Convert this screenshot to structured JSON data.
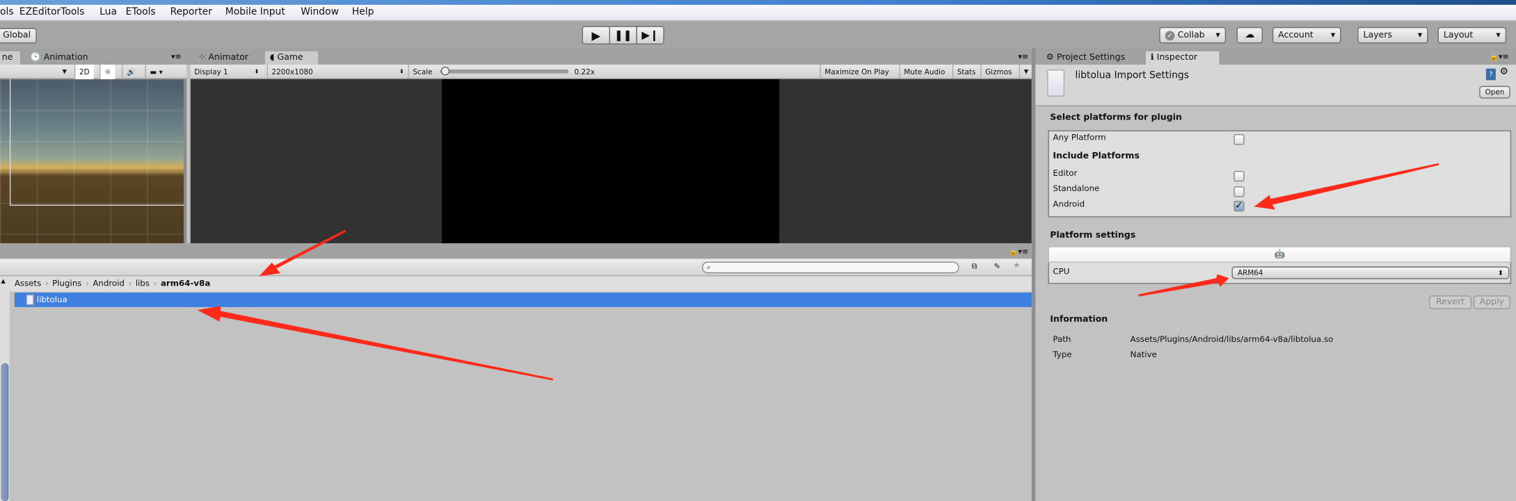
{
  "menu": {
    "items": [
      "ols",
      "EZEditorTools",
      "Lua",
      "ETools",
      "Reporter",
      "Mobile Input",
      "Window",
      "Help"
    ]
  },
  "toolbar": {
    "global_label": "Global",
    "collab_label": "Collab",
    "account_label": "Account",
    "layers_label": "Layers",
    "layout_label": "Layout"
  },
  "scene_panel": {
    "tabs": [
      "ne",
      "Animation"
    ],
    "mode_2d": "2D"
  },
  "game_panel": {
    "tabs": [
      "Animator",
      "Game"
    ],
    "display": "Display 1",
    "resolution": "2200x1080",
    "scale_label": "Scale",
    "scale_value": "0.22x",
    "scale_fraction": 0.02,
    "buttons": [
      "Maximize On Play",
      "Mute Audio",
      "Stats",
      "Gizmos"
    ]
  },
  "project_panel": {
    "breadcrumb": [
      "Assets",
      "Plugins",
      "Android",
      "libs",
      "arm64-v8a"
    ],
    "files": [
      "libtolua"
    ],
    "search_placeholder": ""
  },
  "inspector": {
    "tabs": [
      "Project Settings",
      "Inspector"
    ],
    "title": "libtolua Import Settings",
    "open_label": "Open",
    "select_platforms_heading": "Select platforms for plugin",
    "any_platform": {
      "label": "Any Platform",
      "checked": false
    },
    "include_heading": "Include Platforms",
    "platforms": [
      {
        "label": "Editor",
        "checked": false
      },
      {
        "label": "Standalone",
        "checked": false
      },
      {
        "label": "Android",
        "checked": true
      }
    ],
    "platform_settings_heading": "Platform settings",
    "cpu_label": "CPU",
    "cpu_value": "ARM64",
    "revert_label": "Revert",
    "apply_label": "Apply",
    "information_heading": "Information",
    "path_label": "Path",
    "path_value": "Assets/Plugins/Android/libs/arm64-v8a/libtolua.so",
    "type_label": "Type",
    "type_value": "Native"
  },
  "colors": {
    "selection": "#3d80df",
    "annotation_arrow": "#ff2a1a",
    "editor_bg": "#c2c2c2"
  }
}
